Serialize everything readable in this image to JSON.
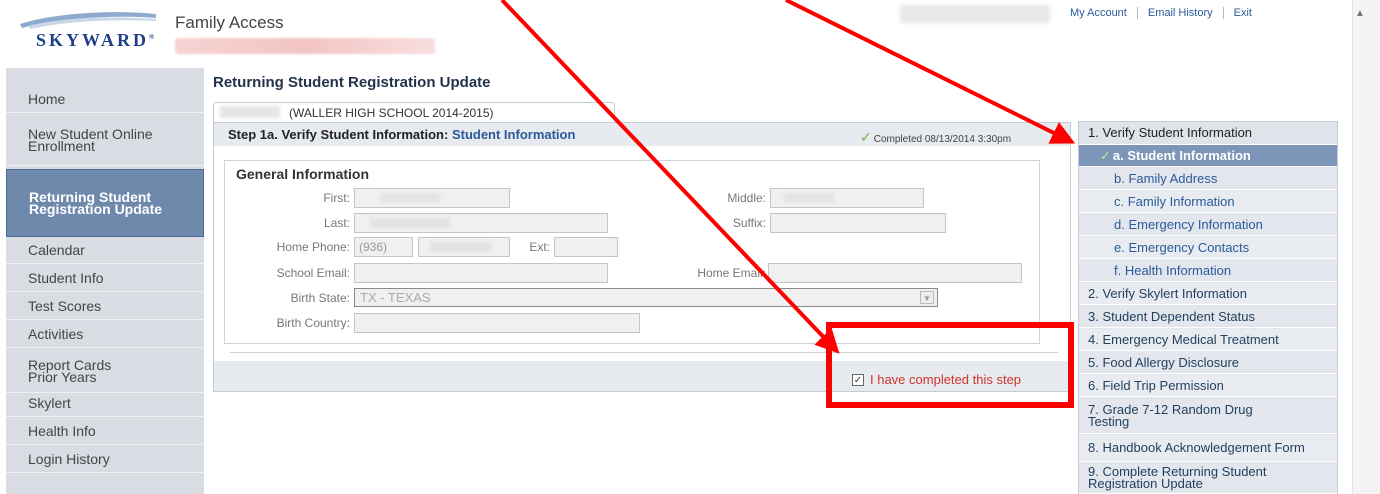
{
  "header": {
    "logo_text": "SKYWARD",
    "logo_mark": "®",
    "app_title": "Family Access",
    "links": [
      "My Account",
      "Email History",
      "Exit"
    ]
  },
  "leftnav": {
    "items": [
      {
        "label": "Home",
        "active": false
      },
      {
        "label": "New Student Online Enrollment",
        "active": false
      },
      {
        "label": "Returning Student Registration Update",
        "active": true
      },
      {
        "label": "Calendar",
        "active": false
      },
      {
        "label": "Student Info",
        "active": false
      },
      {
        "label": "Test Scores",
        "active": false
      },
      {
        "label": "Activities",
        "active": false
      },
      {
        "label": "Report Cards Prior Years",
        "active": false
      },
      {
        "label": "Skylert",
        "active": false
      },
      {
        "label": "Health Info",
        "active": false
      },
      {
        "label": "Login History",
        "active": false
      }
    ]
  },
  "main": {
    "page_title": "Returning Student Registration Update",
    "tab_label": "(WALLER HIGH SCHOOL 2014-2015)",
    "step_title": "Step 1a. Verify Student Information:",
    "step_link": "Student Information",
    "completed_text": "Completed 08/13/2014 3:30pm",
    "section_title": "General Information",
    "labels": {
      "first": "First:",
      "middle": "Middle:",
      "last": "Last:",
      "suffix": "Suffix:",
      "home_phone": "Home Phone:",
      "ext": "Ext:",
      "school_email": "School Email:",
      "home_email": "Home Email:",
      "birth_state": "Birth State:",
      "birth_country": "Birth Country:"
    },
    "values": {
      "home_phone_area": "(936)",
      "birth_state": "TX - TEXAS"
    },
    "checkbox_label": "I have completed this step",
    "checkbox_checked": true
  },
  "steps": [
    {
      "label": "1. Verify Student Information",
      "kind": "head"
    },
    {
      "label": "a. Student Information",
      "kind": "active"
    },
    {
      "label": "b. Family Address",
      "kind": "sub"
    },
    {
      "label": "c. Family Information",
      "kind": "sub"
    },
    {
      "label": "d. Emergency Information",
      "kind": "sub"
    },
    {
      "label": "e. Emergency Contacts",
      "kind": "sub"
    },
    {
      "label": "f. Health Information",
      "kind": "sub"
    },
    {
      "label": "2. Verify Skylert Information",
      "kind": "item"
    },
    {
      "label": "3. Student Dependent Status",
      "kind": "item"
    },
    {
      "label": "4. Emergency Medical Treatment",
      "kind": "item"
    },
    {
      "label": "5. Food Allergy Disclosure",
      "kind": "item"
    },
    {
      "label": "6. Field Trip Permission",
      "kind": "item"
    },
    {
      "label": "7. Grade 7-12 Random Drug Testing",
      "kind": "item"
    },
    {
      "label": "8. Handbook Acknowledgement Form",
      "kind": "item"
    },
    {
      "label": "9. Complete Returning Student Registration Update",
      "kind": "item"
    }
  ],
  "colors": {
    "annotation": "#ff0000",
    "active_nav": "#6f89ad",
    "active_step": "#7c95b8",
    "link": "#2a5a9a",
    "checkbox_label": "#d0342c"
  }
}
